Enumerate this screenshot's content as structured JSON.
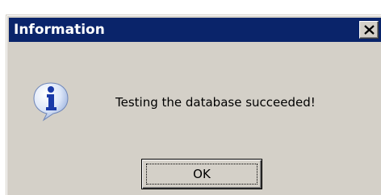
{
  "dialog": {
    "title": "Information",
    "message": "Testing the database succeeded!",
    "ok_label": "OK",
    "icon": "information-icon",
    "close_icon": "close-icon"
  },
  "colors": {
    "titlebar": "#0a246a",
    "title_text": "#ffffff",
    "dialog_background": "#d4d0c8",
    "text": "#000000"
  }
}
